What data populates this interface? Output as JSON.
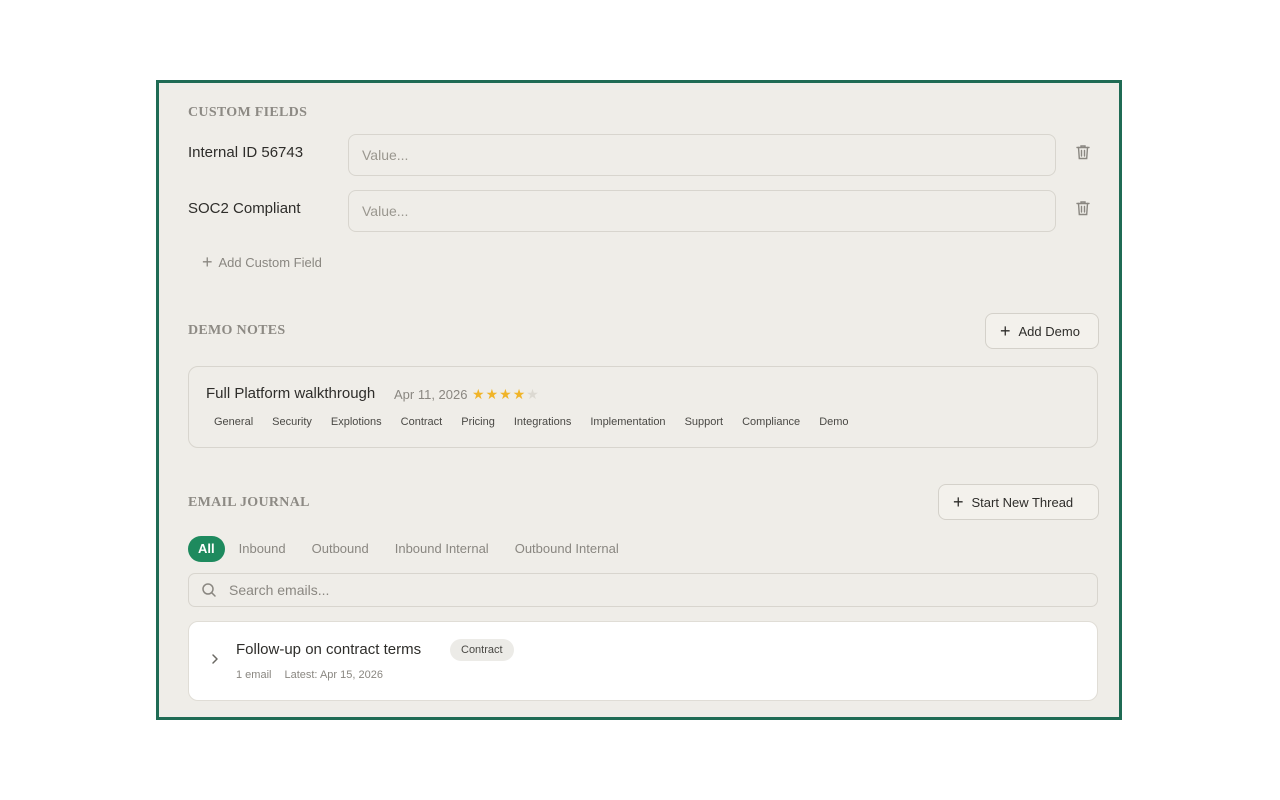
{
  "custom_fields": {
    "title": "CUSTOM FIELDS",
    "rows": [
      {
        "label": "Internal ID 56743",
        "value": "",
        "placeholder": "Value..."
      },
      {
        "label": "SOC2 Compliant",
        "value": "",
        "placeholder": "Value..."
      }
    ],
    "add_label": "Add Custom Field",
    "delete_icon": "trash-icon"
  },
  "demo_notes": {
    "title": "DEMO NOTES",
    "add_button": "Add Demo",
    "demo": {
      "title": "Full Platform walkthrough",
      "date": "Apr 11, 2026",
      "rating": 4,
      "rating_max": 5,
      "tags": [
        "General",
        "Security",
        "Explotions",
        "Contract",
        "Pricing",
        "Integrations",
        "Implementation",
        "Support",
        "Compliance",
        "Demo"
      ]
    }
  },
  "email_journal": {
    "title": "EMAIL JOURNAL",
    "new_thread_button": "Start New Thread",
    "filters": [
      "All",
      "Inbound",
      "Outbound",
      "Inbound Internal",
      "Outbound Internal"
    ],
    "active_filter": "All",
    "search": {
      "placeholder": "Search emails...",
      "value": ""
    },
    "threads": [
      {
        "subject": "Follow-up on contract terms",
        "tag": "Contract",
        "count": "1 email",
        "latest": "Latest: Apr 15, 2026"
      }
    ]
  },
  "colors": {
    "frame_border": "#1f6b54",
    "panel_bg": "#efede8",
    "accent": "#1e8a5e",
    "star": "#f0b429"
  }
}
